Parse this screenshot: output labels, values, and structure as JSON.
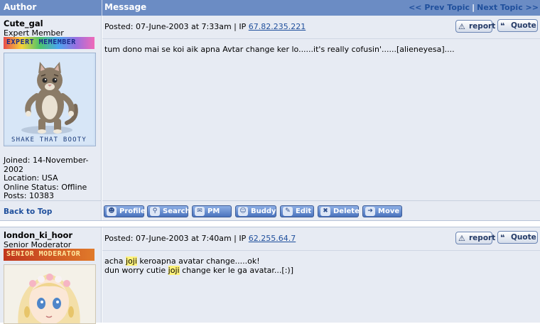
{
  "header": {
    "author_label": "Author",
    "message_label": "Message",
    "prev_topic": "<< Prev Topic",
    "separator": "|",
    "next_topic": "Next Topic >>"
  },
  "post1": {
    "username": "Cute_gal",
    "rank": "Expert Member",
    "rank_badge": "EXPERT MEMEMBER",
    "avatar_caption": "SHAKE THAT BOOTY",
    "posted_prefix": "Posted: 07-June-2003 at 7:33am | IP",
    "ip": "67.82.235.221",
    "message": "tum dono mai se koi aik apna Avtar change ker lo......it's really cofusin'......[alieneyesa]....",
    "joined_line1": "Joined: 14-November-",
    "joined_line2": "2002",
    "location": "Location: USA",
    "online_status": "Online Status: Offline",
    "posts": "Posts: 10383",
    "back_to_top": "Back to Top"
  },
  "post2": {
    "username": "london_ki_hoor",
    "rank": "Senior Moderator",
    "rank_badge": "SENIOR MODERATOR",
    "posted_prefix": "Posted: 07-June-2003 at 7:40am | IP",
    "ip": "62.255.64.7",
    "line1_pre": "acha ",
    "line1_hl": "joji",
    "line1_post": " keroapna avatar change.....ok!",
    "line2_pre": "dun worry cutie ",
    "line2_hl": "joji",
    "line2_post": " change ker le ga avatar...[:)]"
  },
  "buttons": {
    "report": "report",
    "quote": "Quote",
    "profile": "Profile",
    "search": "Search",
    "pm": "PM",
    "buddy": "Buddy",
    "edit": "Edit",
    "delete": "Delete",
    "move": "Move"
  },
  "colors": {
    "header_bg": "#6b8cc4",
    "row_bg": "#e7ebf3",
    "link": "#1f4f9c",
    "highlight": "#fff27a"
  }
}
